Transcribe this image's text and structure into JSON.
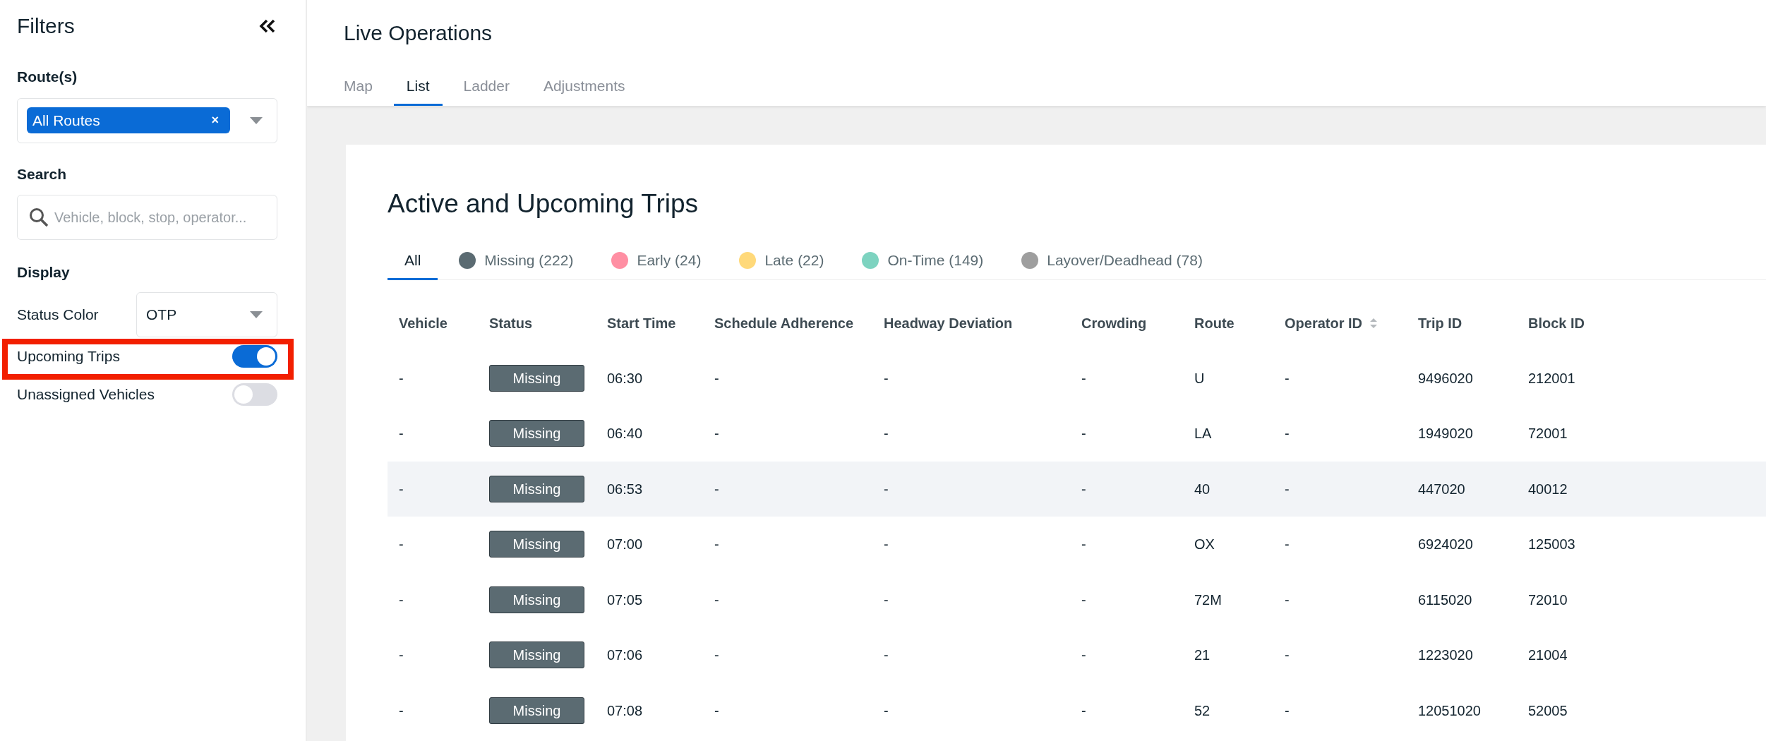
{
  "sidebar": {
    "title": "Filters",
    "routes": {
      "label": "Route(s)",
      "chips": [
        "All Routes"
      ],
      "chip_remove": "×"
    },
    "search": {
      "label": "Search",
      "placeholder": "Vehicle, block, stop, operator..."
    },
    "display": {
      "label": "Display",
      "status_color": {
        "label": "Status Color",
        "value": "OTP"
      },
      "toggles": [
        {
          "label": "Upcoming Trips",
          "on": true,
          "highlighted": true
        },
        {
          "label": "Unassigned Vehicles",
          "on": false,
          "highlighted": false
        }
      ]
    }
  },
  "header": {
    "title": "Live Operations",
    "tabs": [
      {
        "label": "Map",
        "selected": false
      },
      {
        "label": "List",
        "selected": true
      },
      {
        "label": "Ladder",
        "selected": false
      },
      {
        "label": "Adjustments",
        "selected": false
      }
    ]
  },
  "trips": {
    "title": "Active and Upcoming Trips",
    "filters": [
      {
        "label": "All",
        "selected": true
      },
      {
        "label": "Missing (222)",
        "selected": false,
        "color": "#5b6b72"
      },
      {
        "label": "Early (24)",
        "selected": false,
        "color": "#ff8fa3"
      },
      {
        "label": "Late (22)",
        "selected": false,
        "color": "#ffd97a"
      },
      {
        "label": "On-Time (149)",
        "selected": false,
        "color": "#7dd3c0"
      },
      {
        "label": "Layover/Deadhead (78)",
        "selected": false,
        "color": "#9e9e9e"
      }
    ],
    "table": {
      "columns": [
        {
          "label": "Vehicle"
        },
        {
          "label": "Status"
        },
        {
          "label": "Start Time"
        },
        {
          "label": "Schedule Adherence"
        },
        {
          "label": "Headway Deviation"
        },
        {
          "label": "Crowding"
        },
        {
          "label": "Route"
        },
        {
          "label": "Operator ID",
          "sortable": true
        },
        {
          "label": "Trip ID"
        },
        {
          "label": "Block ID"
        }
      ],
      "rows": [
        {
          "selected": false,
          "cells": [
            "-",
            "Missing",
            "06:30",
            "-",
            "-",
            "-",
            "U",
            "-",
            "9496020",
            "212001"
          ]
        },
        {
          "selected": false,
          "cells": [
            "-",
            "Missing",
            "06:40",
            "-",
            "-",
            "-",
            "LA",
            "-",
            "1949020",
            "72001"
          ]
        },
        {
          "selected": true,
          "cells": [
            "-",
            "Missing",
            "06:53",
            "-",
            "-",
            "-",
            "40",
            "-",
            "447020",
            "40012"
          ]
        },
        {
          "selected": false,
          "cells": [
            "-",
            "Missing",
            "07:00",
            "-",
            "-",
            "-",
            "OX",
            "-",
            "6924020",
            "125003"
          ]
        },
        {
          "selected": false,
          "cells": [
            "-",
            "Missing",
            "07:05",
            "-",
            "-",
            "-",
            "72M",
            "-",
            "6115020",
            "72010"
          ]
        },
        {
          "selected": false,
          "cells": [
            "-",
            "Missing",
            "07:06",
            "-",
            "-",
            "-",
            "21",
            "-",
            "1223020",
            "21004"
          ]
        },
        {
          "selected": false,
          "cells": [
            "-",
            "Missing",
            "07:08",
            "-",
            "-",
            "-",
            "52",
            "-",
            "12051020",
            "52005"
          ]
        }
      ]
    }
  }
}
